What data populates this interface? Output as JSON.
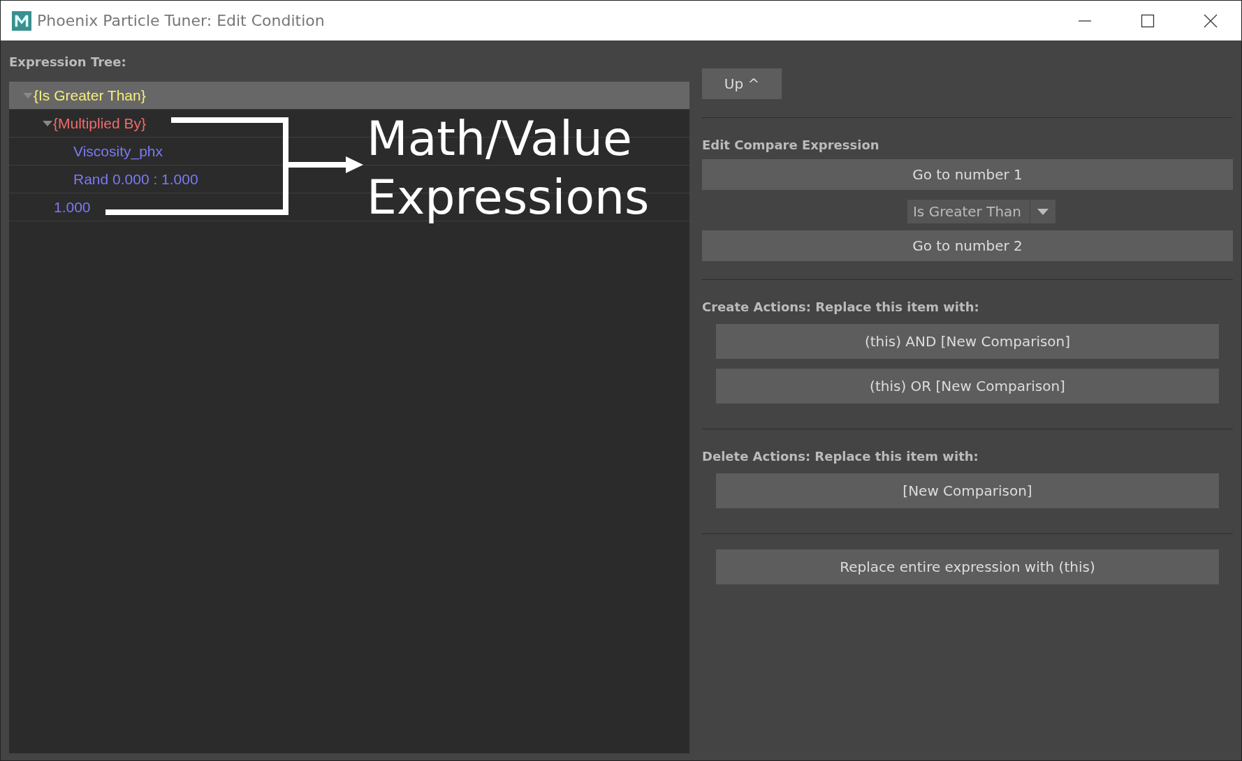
{
  "window": {
    "title": "Phoenix Particle Tuner: Edit Condition"
  },
  "tree": {
    "label": "Expression Tree:",
    "nodes": [
      {
        "label": "{Is Greater Than}",
        "color": "#f5f07a",
        "selected": true,
        "expanded": true,
        "children": [
          {
            "label": "{Multiplied By}",
            "color": "#f26b6b",
            "selected": false,
            "expanded": true,
            "children": [
              {
                "label": "Viscosity_phx",
                "color": "#7a7af5",
                "selected": false
              },
              {
                "label": "Rand 0.000 : 1.000",
                "color": "#7a7af5",
                "selected": false
              }
            ]
          },
          {
            "label": "1.000",
            "color": "#7a7af5",
            "selected": false
          }
        ]
      }
    ]
  },
  "annotation": {
    "lines": [
      "Math/Value",
      "Expressions"
    ]
  },
  "up_button": "Up ^",
  "compare": {
    "heading": "Edit Compare Expression",
    "first": "Go to number 1",
    "operator": "Is Greater Than",
    "second": "Go to number 2"
  },
  "create_actions": {
    "heading": "Create Actions: Replace this item with:",
    "buttons": [
      "(this) AND [New Comparison]",
      "(this) OR [New Comparison]"
    ]
  },
  "delete_actions": {
    "heading": "Delete Actions: Replace this item with:",
    "buttons": [
      "[New Comparison]"
    ]
  },
  "replace_button": "Replace entire expression with (this)"
}
